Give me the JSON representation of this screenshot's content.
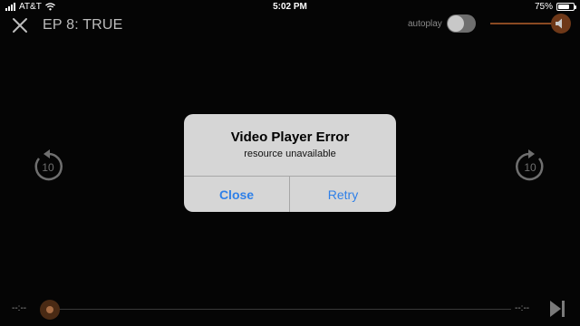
{
  "status_bar": {
    "carrier": "AT&T",
    "time": "5:02 PM",
    "battery_percent_label": "75%",
    "battery_level": 0.75
  },
  "header": {
    "episode_title": "EP 8: TRUE",
    "autoplay_label": "autoplay",
    "autoplay_enabled": false
  },
  "controls": {
    "skip_back_seconds": "10",
    "skip_forward_seconds": "10",
    "volume_level": 0.95
  },
  "dialog": {
    "title": "Video Player Error",
    "message": "resource unavailable",
    "close_label": "Close",
    "retry_label": "Retry"
  },
  "playback": {
    "elapsed_time": "--:--",
    "remaining_time": "--:--",
    "progress": 0
  },
  "colors": {
    "accent": "#8a4a22",
    "dialog_button": "#2f80e8"
  },
  "icons": [
    "cellular-signal-icon",
    "wifi-icon",
    "battery-icon",
    "close-icon",
    "speaker-icon",
    "replay-10-icon",
    "forward-10-icon",
    "skip-next-icon"
  ]
}
